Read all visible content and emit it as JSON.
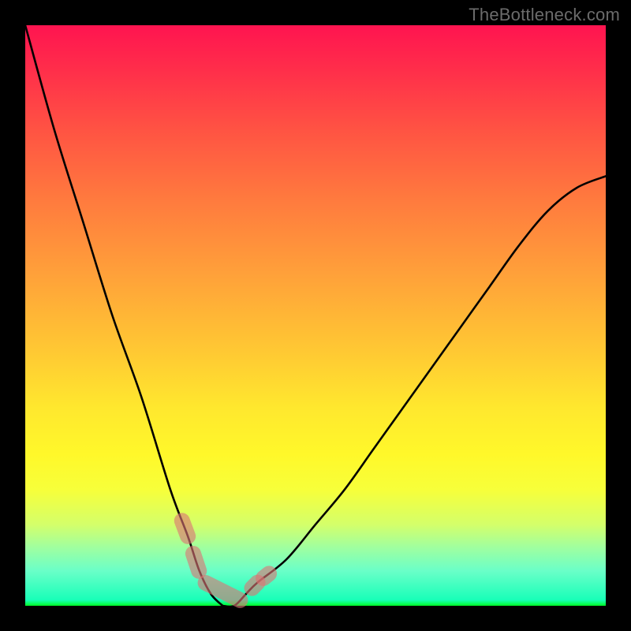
{
  "watermark": "TheBottleneck.com",
  "colors": {
    "frame": "#000000",
    "curve": "#000000",
    "marker": "#dc7574",
    "gradient_top": "#ff1450",
    "gradient_bottom": "#00ff28"
  },
  "chart_data": {
    "type": "line",
    "title": "",
    "xlabel": "",
    "ylabel": "",
    "xlim": [
      0,
      100
    ],
    "ylim": [
      0,
      100
    ],
    "axes_visible": false,
    "grid": false,
    "legend": false,
    "annotations": [
      "TheBottleneck.com"
    ],
    "description": "Bottleneck curve: V-shaped plot where x is component balance and y is bottleneck percent; trough near x≈34 at y≈0 indicates no bottleneck. Axes and ticks are hidden; background vertical gradient red→green encodes severity.",
    "series": [
      {
        "name": "bottleneck",
        "x": [
          0,
          5,
          10,
          15,
          20,
          25,
          28,
          30,
          32,
          34,
          36,
          38,
          40,
          45,
          50,
          55,
          60,
          65,
          70,
          75,
          80,
          85,
          90,
          95,
          100
        ],
        "y": [
          100,
          82,
          66,
          50,
          36,
          20,
          12,
          6,
          2,
          0,
          0,
          2,
          4,
          8,
          14,
          20,
          27,
          34,
          41,
          48,
          55,
          62,
          68,
          72,
          74
        ]
      }
    ],
    "markers": [
      {
        "x_start": 27,
        "x_end": 28,
        "side": "left"
      },
      {
        "x_start": 29,
        "x_end": 30,
        "side": "left"
      },
      {
        "x_start": 31,
        "x_end": 37,
        "side": "bottom"
      },
      {
        "x_start": 39,
        "x_end": 40,
        "side": "right"
      },
      {
        "x_start": 41,
        "x_end": 42,
        "side": "right"
      }
    ]
  }
}
